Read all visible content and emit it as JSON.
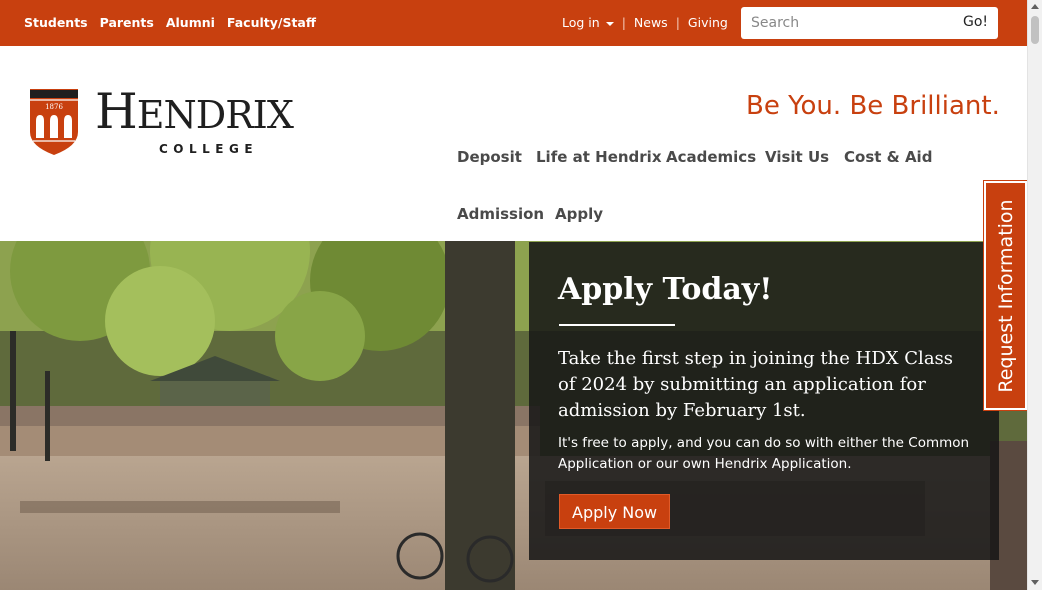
{
  "audience_links": [
    "Students",
    "Parents",
    "Alumni",
    "Faculty/Staff"
  ],
  "utility": {
    "login": "Log in",
    "news": "News",
    "giving": "Giving",
    "separator": "|"
  },
  "search": {
    "placeholder": "Search",
    "button": "Go!"
  },
  "logo": {
    "year": "1876",
    "wordmark_first": "H",
    "wordmark_rest": "ENDRIX",
    "subtitle": "COLLEGE"
  },
  "tagline": "Be You. Be Brilliant.",
  "main_nav": [
    "Deposit",
    "Life at Hendrix",
    "Academics",
    "Visit Us",
    "Cost & Aid",
    "Admission",
    "Apply"
  ],
  "hero": {
    "title": "Apply Today!",
    "lead": "Take the first step in joining the HDX Class of 2024 by submitting an application for admission by February 1st.",
    "note": "It's free to apply, and you can do so with either the Common Application or our own Hendrix Application.",
    "button": "Apply Now"
  },
  "request_tab": "Request Information",
  "colors": {
    "brand_orange": "#c8400f",
    "panel_bg": "#161616",
    "nav_text": "#4a4a4a"
  }
}
